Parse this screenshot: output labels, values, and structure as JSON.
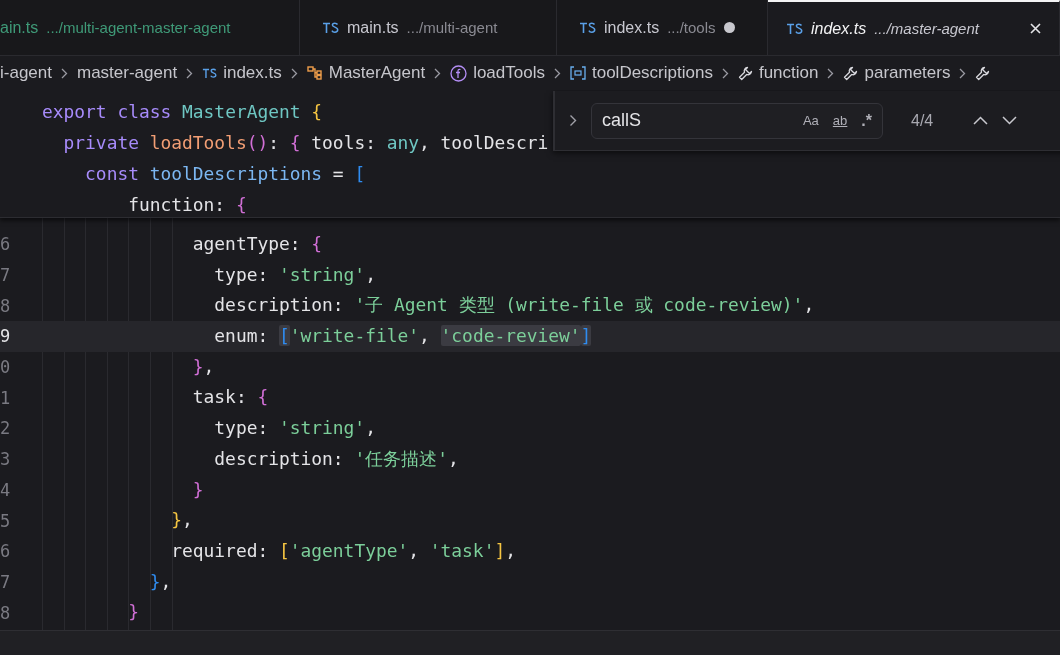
{
  "tabs": [
    {
      "name": "ain.ts",
      "path": ".../multi-agent-master-agent",
      "selected": false,
      "ts_icon": false,
      "modified": false,
      "git_untracked": true
    },
    {
      "name": "main.ts",
      "path": ".../multi-agent",
      "selected": false,
      "ts_icon": true,
      "modified": false,
      "git_untracked": false
    },
    {
      "name": "index.ts",
      "path": ".../tools",
      "selected": false,
      "ts_icon": true,
      "modified": true,
      "git_untracked": false
    },
    {
      "name": "index.ts",
      "path": ".../master-agent",
      "selected": true,
      "ts_icon": true,
      "modified": false,
      "git_untracked": false
    }
  ],
  "breadcrumbs": [
    {
      "label": "i-agent",
      "kind": "folder"
    },
    {
      "label": "master-agent",
      "kind": "folder"
    },
    {
      "label": "index.ts",
      "kind": "ts"
    },
    {
      "label": "MasterAgent",
      "kind": "class"
    },
    {
      "label": "loadTools",
      "kind": "method"
    },
    {
      "label": "toolDescriptions",
      "kind": "variable"
    },
    {
      "label": "function",
      "kind": "property"
    },
    {
      "label": "parameters",
      "kind": "property"
    },
    {
      "kind": "property"
    }
  ],
  "sticky_lines": [
    [
      {
        "text": "export",
        "kind": "keyword"
      },
      {
        "text": " class",
        "kind": "keyword"
      },
      {
        "text": " MasterAgent",
        "kind": "class"
      },
      {
        "text": " {",
        "kind": "brace-yellow"
      }
    ],
    [
      {
        "text": "  private",
        "kind": "keyword"
      },
      {
        "text": " loadTools",
        "kind": "function"
      },
      {
        "text": "()",
        "kind": "brace-pink"
      },
      {
        "text": ":",
        "kind": "plain"
      },
      {
        "text": " {",
        "kind": "brace-pink"
      },
      {
        "text": " tools: ",
        "kind": "plain"
      },
      {
        "text": "any",
        "kind": "type"
      },
      {
        "text": ", toolDescri",
        "kind": "plain"
      }
    ],
    [
      {
        "text": "    const",
        "kind": "keyword"
      },
      {
        "text": " toolDescriptions",
        "kind": "variable"
      },
      {
        "text": " = ",
        "kind": "plain"
      },
      {
        "text": "[",
        "kind": "brace-blue"
      }
    ],
    [
      {
        "text": "        function: ",
        "kind": "plain"
      },
      {
        "text": "{",
        "kind": "brace-pink"
      }
    ]
  ],
  "lines": [
    {
      "number": "6",
      "selected": false,
      "tokens": [
        {
          "text": "              agentType: ",
          "kind": "plain"
        },
        {
          "text": "{",
          "kind": "brace-pink"
        }
      ]
    },
    {
      "number": "7",
      "selected": false,
      "tokens": [
        {
          "text": "                type: ",
          "kind": "plain"
        },
        {
          "text": "'string'",
          "kind": "string"
        },
        {
          "text": ",",
          "kind": "plain"
        }
      ]
    },
    {
      "number": "8",
      "selected": false,
      "tokens": [
        {
          "text": "                description: ",
          "kind": "plain"
        },
        {
          "text": "'子 Agent 类型 (write-file 或 code-review)'",
          "kind": "string"
        },
        {
          "text": ",",
          "kind": "plain"
        }
      ]
    },
    {
      "number": "9",
      "selected": true,
      "tokens": [
        {
          "text": "                enum: ",
          "kind": "plain"
        },
        {
          "text": "[",
          "kind": "bracket-match"
        },
        {
          "text": "'write-file'",
          "kind": "string"
        },
        {
          "text": ", ",
          "kind": "plain"
        },
        {
          "text": "'code-review'",
          "kind": "string-match"
        },
        {
          "text": "]",
          "kind": "bracket-match"
        }
      ]
    },
    {
      "number": "0",
      "selected": false,
      "tokens": [
        {
          "text": "              }",
          "kind": "brace-pink"
        },
        {
          "text": ",",
          "kind": "plain"
        }
      ]
    },
    {
      "number": "1",
      "selected": false,
      "tokens": [
        {
          "text": "              task: ",
          "kind": "plain"
        },
        {
          "text": "{",
          "kind": "brace-pink"
        }
      ]
    },
    {
      "number": "2",
      "selected": false,
      "tokens": [
        {
          "text": "                type: ",
          "kind": "plain"
        },
        {
          "text": "'string'",
          "kind": "string"
        },
        {
          "text": ",",
          "kind": "plain"
        }
      ]
    },
    {
      "number": "3",
      "selected": false,
      "tokens": [
        {
          "text": "                description: ",
          "kind": "plain"
        },
        {
          "text": "'任务描述'",
          "kind": "string"
        },
        {
          "text": ",",
          "kind": "plain"
        }
      ]
    },
    {
      "number": "4",
      "selected": false,
      "tokens": [
        {
          "text": "              }",
          "kind": "brace-pink"
        }
      ]
    },
    {
      "number": "5",
      "selected": false,
      "tokens": [
        {
          "text": "            }",
          "kind": "brace-yellow"
        },
        {
          "text": ",",
          "kind": "plain"
        }
      ]
    },
    {
      "number": "6",
      "selected": false,
      "tokens": [
        {
          "text": "            required: ",
          "kind": "plain"
        },
        {
          "text": "[",
          "kind": "brace-yellow"
        },
        {
          "text": "'agentType'",
          "kind": "string"
        },
        {
          "text": ", ",
          "kind": "plain"
        },
        {
          "text": "'task'",
          "kind": "string"
        },
        {
          "text": "]",
          "kind": "brace-yellow"
        },
        {
          "text": ",",
          "kind": "plain"
        }
      ]
    },
    {
      "number": "7",
      "selected": false,
      "tokens": [
        {
          "text": "          }",
          "kind": "brace-blue"
        },
        {
          "text": ",",
          "kind": "plain"
        }
      ]
    },
    {
      "number": "8",
      "selected": false,
      "tokens": [
        {
          "text": "        }",
          "kind": "brace-pink"
        }
      ]
    }
  ],
  "find": {
    "value": "callS",
    "match_case": "Aa",
    "whole_word": "ab",
    "regex": ".*",
    "count": "4/4"
  }
}
